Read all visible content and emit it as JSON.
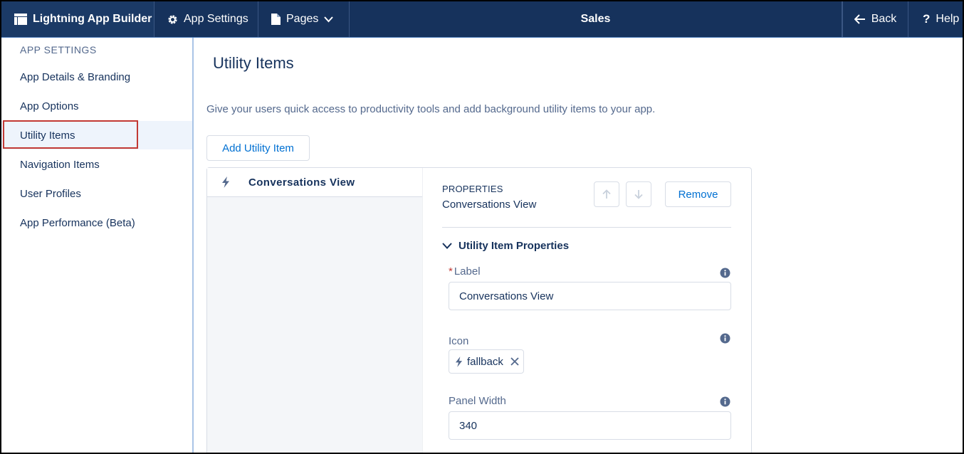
{
  "topbar": {
    "brand": "Lightning App Builder",
    "settings": "App Settings",
    "pages": "Pages",
    "app_name": "Sales",
    "back": "Back",
    "help": "Help"
  },
  "sidebar": {
    "heading": "APP SETTINGS",
    "items": [
      {
        "label": "App Details & Branding"
      },
      {
        "label": "App Options"
      },
      {
        "label": "Utility Items"
      },
      {
        "label": "Navigation Items"
      },
      {
        "label": "User Profiles"
      },
      {
        "label": "App Performance (Beta)"
      }
    ]
  },
  "main": {
    "title": "Utility Items",
    "description": "Give your users quick access to productivity tools and add background utility items to your app.",
    "add_button": "Add Utility Item",
    "list_items": [
      {
        "label": "Conversations View"
      }
    ],
    "properties": {
      "eyebrow": "PROPERTIES",
      "name": "Conversations View",
      "remove_button": "Remove",
      "section_title": "Utility Item Properties",
      "label_field": {
        "required_mark": "*",
        "label": "Label",
        "value": "Conversations View"
      },
      "icon_field": {
        "label": "Icon",
        "value": "fallback"
      },
      "width_field": {
        "label": "Panel Width",
        "value": "340"
      }
    }
  },
  "colors": {
    "topbar": "#16325c",
    "accent": "#0070d2",
    "selected_outline": "#c23934"
  }
}
